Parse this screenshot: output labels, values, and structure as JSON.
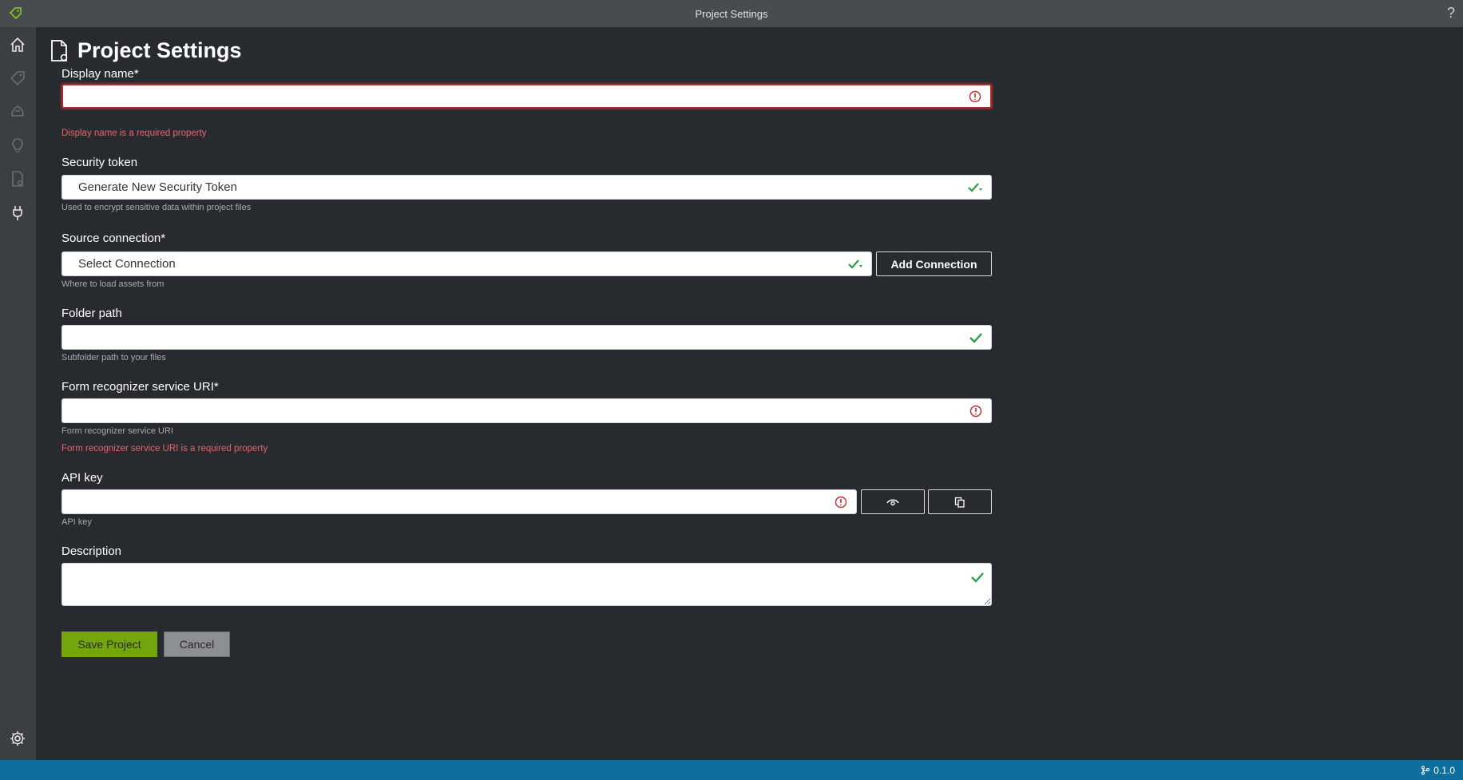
{
  "window": {
    "title": "Project Settings",
    "help_label": "?"
  },
  "page": {
    "title": "Project Settings"
  },
  "sidebar": {
    "items": [
      {
        "name": "home",
        "icon": "home-icon"
      },
      {
        "name": "tag-editor",
        "icon": "tag-icon"
      },
      {
        "name": "train",
        "icon": "train-icon"
      },
      {
        "name": "analyze",
        "icon": "lightbulb-icon"
      },
      {
        "name": "project-settings",
        "icon": "document-settings-icon"
      },
      {
        "name": "connections",
        "icon": "plug-icon"
      },
      {
        "name": "app-settings",
        "icon": "gear-icon"
      }
    ]
  },
  "form": {
    "display_name": {
      "label": "Display name*",
      "value": "",
      "error": "Display name is a required property"
    },
    "security_token": {
      "label": "Security token",
      "value": "Generate New Security Token",
      "help": "Used to encrypt sensitive data within project files"
    },
    "source_connection": {
      "label": "Source connection*",
      "value": "Select Connection",
      "help": "Where to load assets from",
      "add_button": "Add Connection"
    },
    "folder_path": {
      "label": "Folder path",
      "value": "",
      "help": "Subfolder path to your files"
    },
    "service_uri": {
      "label": "Form recognizer service URI*",
      "value": "",
      "help": "Form recognizer service URI",
      "error": "Form recognizer service URI is a required property"
    },
    "api_key": {
      "label": "API key",
      "value": "",
      "help": "API key"
    },
    "description": {
      "label": "Description",
      "value": ""
    }
  },
  "actions": {
    "save": "Save Project",
    "cancel": "Cancel"
  },
  "status_bar": {
    "version": "0.1.0"
  },
  "colors": {
    "accent": "#74a50d",
    "error": "#e8636a",
    "status_bar": "#0e6ea0",
    "valid": "#2e9e46"
  }
}
